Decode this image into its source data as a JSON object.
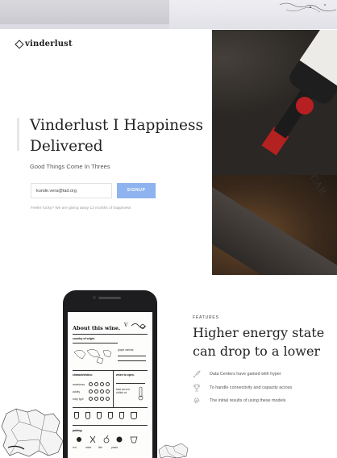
{
  "brand": {
    "name": "vinderlust"
  },
  "hero": {
    "title": "Vinderlust I Happiness Delivered",
    "subtitle": "Good Things Come In Threes",
    "email_value": "kunde.vera@tad.org",
    "signup_label": "SIGNUP",
    "fine_print": "Feelin' lucky? We are giving away 12 months of happiness"
  },
  "photo": {
    "label_text": "CAR"
  },
  "phone_screen": {
    "title": "About this wine.",
    "logo": "V",
    "country": "country of origin.",
    "grape": "grape varietal",
    "characteristics": "characteristics:",
    "sweetness": "sweetness",
    "acidity": "acidity",
    "body": "body type",
    "when_to_open": "when to open.",
    "best_served": "best served chilled at:",
    "pairing": "pairing:",
    "tags": [
      "red",
      "meat",
      "fish",
      "pasta"
    ]
  },
  "features": {
    "label": "FEATURES",
    "title": "Higher energy state can drop to a lower",
    "items": [
      {
        "icon": "rocket-icon",
        "text": "Data Centers have gained  with hyper"
      },
      {
        "icon": "trophy-icon",
        "text": "To handle connectivity and capacity across"
      },
      {
        "icon": "fingerprint-icon",
        "text": "The initial results of using these models"
      }
    ]
  },
  "colors": {
    "accent": "#8fb3ef",
    "text_dark": "#222222",
    "muted": "#9a9a9a"
  }
}
